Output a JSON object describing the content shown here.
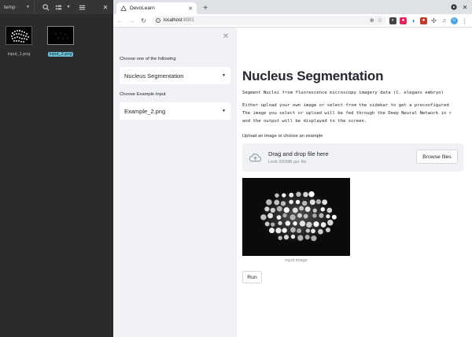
{
  "file_manager": {
    "location": "temp",
    "files": [
      {
        "name": "input_1.png",
        "selected": false
      },
      {
        "name": "input_2.png",
        "selected": true
      }
    ]
  },
  "browser": {
    "tab_title": "DevoLearn",
    "url_host": "localhost",
    "url_port": ":8501"
  },
  "sidebar": {
    "mode_label": "Choose one of the following",
    "mode_value": "Nucleus Segmentation",
    "example_label": "Choose Example Input",
    "example_value": "Example_2.png"
  },
  "main": {
    "title": "Nucleus Segmentation",
    "subtitle": "Segment Nuclei from fluorescence microscopy imagery data (C. elegans embryo)",
    "desc_1": "Either upload your own image or select from the sidebar to get a preconfigured",
    "desc_2": "The image you select or upload will be fed through the Deep Neural Network in r",
    "desc_3": "and the output will be displayed to the screen.",
    "upload_label": "Upload an image or choose an example",
    "drop_text": "Drag and drop file here",
    "limit_text": "Limit 200MB per file",
    "browse_label": "Browse files",
    "image_caption": "input image",
    "run_label": "Run"
  },
  "colors": {
    "sidebar_bg": "#f0f2f6",
    "text": "#262730",
    "file_highlight": "#6cc1d6"
  }
}
